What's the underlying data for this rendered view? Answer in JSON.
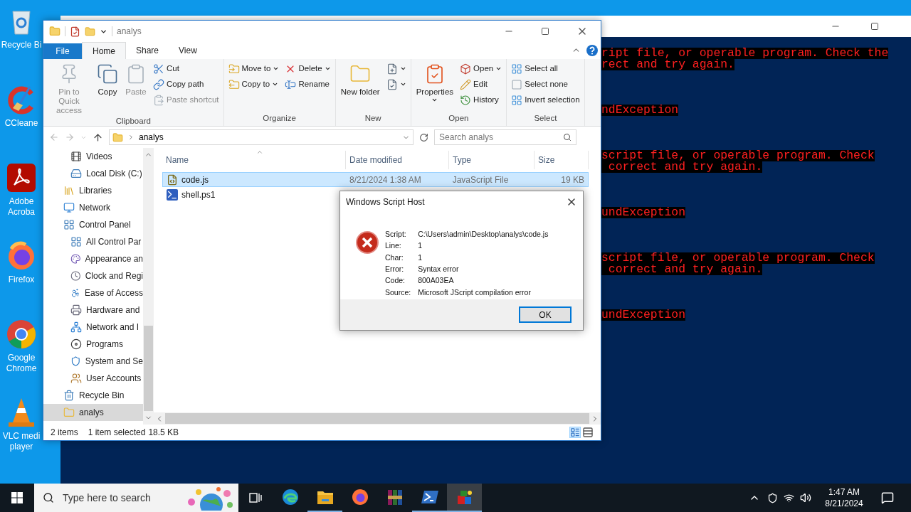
{
  "desktop_icons": [
    {
      "lines": [
        "Recycle Bi"
      ]
    },
    {
      "lines": [
        "CCleane"
      ]
    },
    {
      "lines": [
        "Adobe",
        "Acroba"
      ]
    },
    {
      "lines": [
        "Firefox"
      ]
    },
    {
      "lines": [
        "Google",
        "Chrome"
      ]
    },
    {
      "lines": [
        "VLC medi",
        "player"
      ]
    }
  ],
  "console": {
    "blocks": [
      {
        "lines": [
          "ript file, or operable program. Check the",
          "rect and try again."
        ]
      },
      {
        "lines": [
          "ndException"
        ]
      },
      {
        "lines": [
          "script file, or operable program. Check",
          " correct and try again."
        ]
      },
      {
        "lines": [
          "undException"
        ]
      },
      {
        "lines": [
          "script file, or operable program. Check",
          " correct and try again."
        ]
      },
      {
        "lines": [
          "undException"
        ]
      }
    ]
  },
  "explorer": {
    "title": "analys",
    "tabs": [
      {
        "label": "File",
        "kind": "file",
        "selected": false
      },
      {
        "label": "Home",
        "kind": "tab",
        "selected": true
      },
      {
        "label": "Share",
        "kind": "tab",
        "selected": false
      },
      {
        "label": "View",
        "kind": "tab",
        "selected": false
      }
    ],
    "ribbon": [
      {
        "label": "Clipboard",
        "columns": [
          {
            "kind": "large",
            "buttons": [
              {
                "label": "Pin to Quick access",
                "disabled": true,
                "dropdown": false
              }
            ]
          },
          {
            "kind": "large",
            "buttons": [
              {
                "label": "Copy",
                "disabled": false,
                "dropdown": false
              }
            ]
          },
          {
            "kind": "large",
            "buttons": [
              {
                "label": "Paste",
                "disabled": true,
                "dropdown": false
              }
            ]
          },
          {
            "kind": "small",
            "buttons": [
              {
                "label": "Cut",
                "disabled": false,
                "dropdown": false
              },
              {
                "label": "Copy path",
                "disabled": false,
                "dropdown": false
              },
              {
                "label": "Paste shortcut",
                "disabled": true,
                "dropdown": false
              }
            ]
          }
        ]
      },
      {
        "label": "Organize",
        "columns": [
          {
            "kind": "small",
            "buttons": [
              {
                "label": "Move to",
                "disabled": false,
                "dropdown": true
              },
              {
                "label": "Copy to",
                "disabled": false,
                "dropdown": true
              }
            ]
          },
          {
            "kind": "small",
            "buttons": [
              {
                "label": "Delete",
                "disabled": false,
                "dropdown": true
              },
              {
                "label": "Rename",
                "disabled": false,
                "dropdown": false
              }
            ]
          }
        ]
      },
      {
        "label": "New",
        "columns": [
          {
            "kind": "large",
            "buttons": [
              {
                "label": "New folder",
                "disabled": false,
                "dropdown": false
              }
            ]
          },
          {
            "kind": "small",
            "buttons": [
              {
                "disabled": false,
                "dropdown": true
              },
              {
                "disabled": false,
                "dropdown": true
              }
            ]
          }
        ]
      },
      {
        "label": "Open",
        "columns": [
          {
            "kind": "large",
            "buttons": [
              {
                "label": "Properties",
                "disabled": false,
                "dropdown": true
              }
            ]
          },
          {
            "kind": "small",
            "buttons": [
              {
                "label": "Open",
                "disabled": false,
                "dropdown": true
              },
              {
                "label": "Edit",
                "disabled": false,
                "dropdown": false
              },
              {
                "label": "History",
                "disabled": false,
                "dropdown": false
              }
            ]
          }
        ]
      },
      {
        "label": "Select",
        "columns": [
          {
            "kind": "small",
            "buttons": [
              {
                "label": "Select all",
                "disabled": false,
                "dropdown": false
              },
              {
                "label": "Select none",
                "disabled": false,
                "dropdown": false
              },
              {
                "label": "Invert selection",
                "disabled": false,
                "dropdown": false
              }
            ]
          }
        ]
      }
    ],
    "address": {
      "path": "analys"
    },
    "search": {
      "placeholder": "Search analys"
    },
    "nav": [
      {
        "children": [
          {
            "label": "Videos",
            "selected": false
          },
          {
            "label": "Local Disk (C:)",
            "selected": false
          }
        ]
      },
      {
        "label": "Libraries",
        "selected": false
      },
      {
        "label": "Network",
        "selected": false
      },
      {
        "label": "Control Panel",
        "selected": false,
        "children": [
          {
            "label": "All Control Par",
            "selected": false
          },
          {
            "label": "Appearance an",
            "selected": false
          },
          {
            "label": "Clock and Regi",
            "selected": false
          },
          {
            "label": "Ease of Access",
            "selected": false
          },
          {
            "label": "Hardware and",
            "selected": false
          },
          {
            "label": "Network and I",
            "selected": false
          },
          {
            "label": "Programs",
            "selected": false
          },
          {
            "label": "System and Se",
            "selected": false
          },
          {
            "label": "User Accounts",
            "selected": false
          }
        ]
      },
      {
        "label": "Recycle Bin",
        "selected": false
      },
      {
        "label": "analys",
        "selected": true
      }
    ],
    "columns": [
      "Name",
      "Date modified",
      "Type",
      "Size"
    ],
    "files": [
      {
        "kind": "js",
        "selected": true,
        "cells": [
          "code.js",
          "8/21/2024 1:38 AM",
          "JavaScript File",
          "19 KB"
        ]
      },
      {
        "kind": "ps",
        "selected": false,
        "cells": [
          "shell.ps1"
        ]
      }
    ],
    "status": {
      "count": "2 items",
      "selection": "1 item selected",
      "size": "18.5 KB"
    }
  },
  "dialog": {
    "title": "Windows Script Host",
    "fields": [
      {
        "label": "Script:",
        "value": "C:\\Users\\admin\\Desktop\\analys\\code.js"
      },
      {
        "label": "Line:",
        "value": "1"
      },
      {
        "label": "Char:",
        "value": "1"
      },
      {
        "label": "Error:",
        "value": "Syntax error"
      },
      {
        "label": "Code:",
        "value": "800A03EA"
      },
      {
        "label": "Source:",
        "value": "Microsoft JScript compilation error"
      }
    ],
    "button": "OK"
  },
  "taskbar": {
    "search": {
      "placeholder": "Type here to search"
    },
    "apps": [
      {
        "running": false,
        "selected": false
      },
      {
        "running": true,
        "selected": false
      },
      {
        "running": false,
        "selected": false
      },
      {
        "running": false,
        "selected": false
      },
      {
        "running": true,
        "selected": false
      },
      {
        "running": true,
        "selected": true
      }
    ],
    "time": "1:47 AM",
    "date": "8/21/2024"
  }
}
